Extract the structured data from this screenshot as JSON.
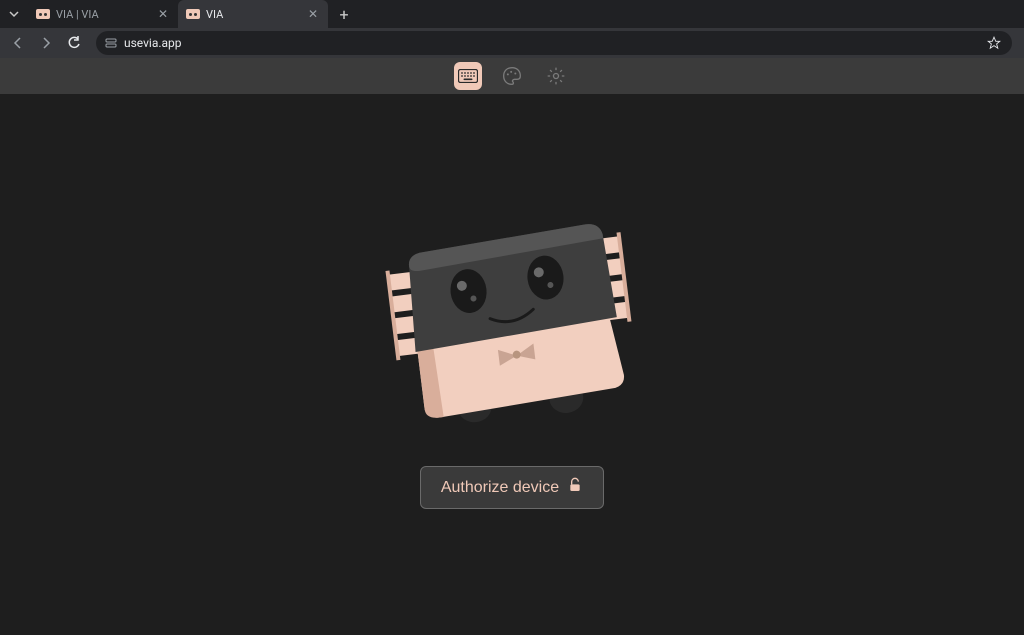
{
  "browser": {
    "tabs": [
      {
        "title": "VIA | VIA",
        "active": false
      },
      {
        "title": "VIA",
        "active": true
      }
    ],
    "url": "usevia.app"
  },
  "topbar": {
    "icons": [
      {
        "name": "keyboard-icon",
        "active": true
      },
      {
        "name": "paint-icon",
        "active": false
      },
      {
        "name": "settings-icon",
        "active": false
      }
    ]
  },
  "main": {
    "authorize_label": "Authorize device"
  },
  "colors": {
    "accent": "#f0c9b8",
    "bg_dark": "#1e1e1e",
    "chrome_dark": "#202124",
    "chrome_mid": "#35363a"
  }
}
